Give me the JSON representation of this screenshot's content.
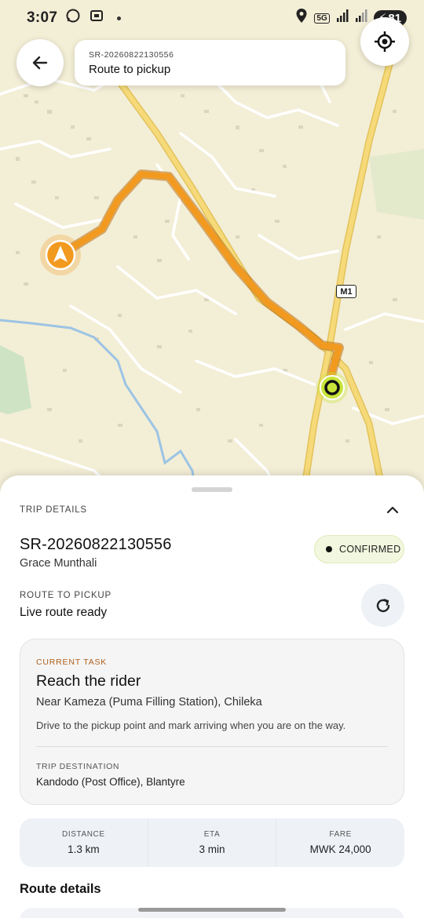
{
  "status_bar": {
    "time": "3:07",
    "network": "5G",
    "battery": "81"
  },
  "header": {
    "trip_code": "SR-20260822130556",
    "title": "Route to pickup"
  },
  "map": {
    "road_label": "M1",
    "route_color": "#f29a1f",
    "road_color": "#f5d267"
  },
  "sheet": {
    "section_label": "TRIP DETAILS",
    "trip_code": "SR-20260822130556",
    "rider_name": "Grace Munthali",
    "status": "CONFIRMED",
    "route_label": "ROUTE TO PICKUP",
    "route_status": "Live route ready",
    "task": {
      "label": "CURRENT TASK",
      "title": "Reach the rider",
      "place": "Near Kameza (Puma Filling Station), Chileka",
      "description": "Drive to the pickup point and mark arriving when you are on the way.",
      "destination_label": "TRIP DESTINATION",
      "destination": "Kandodo (Post Office), Blantyre"
    },
    "stats": [
      {
        "label": "DISTANCE",
        "value": "1.3 km"
      },
      {
        "label": "ETA",
        "value": "3 min"
      },
      {
        "label": "FARE",
        "value": "MWK 24,000"
      }
    ],
    "route_details_title": "Route details"
  },
  "colors": {
    "accent_orange": "#f29a1f",
    "pickup_green": "#c8e43a",
    "task_label": "#b1601a"
  }
}
